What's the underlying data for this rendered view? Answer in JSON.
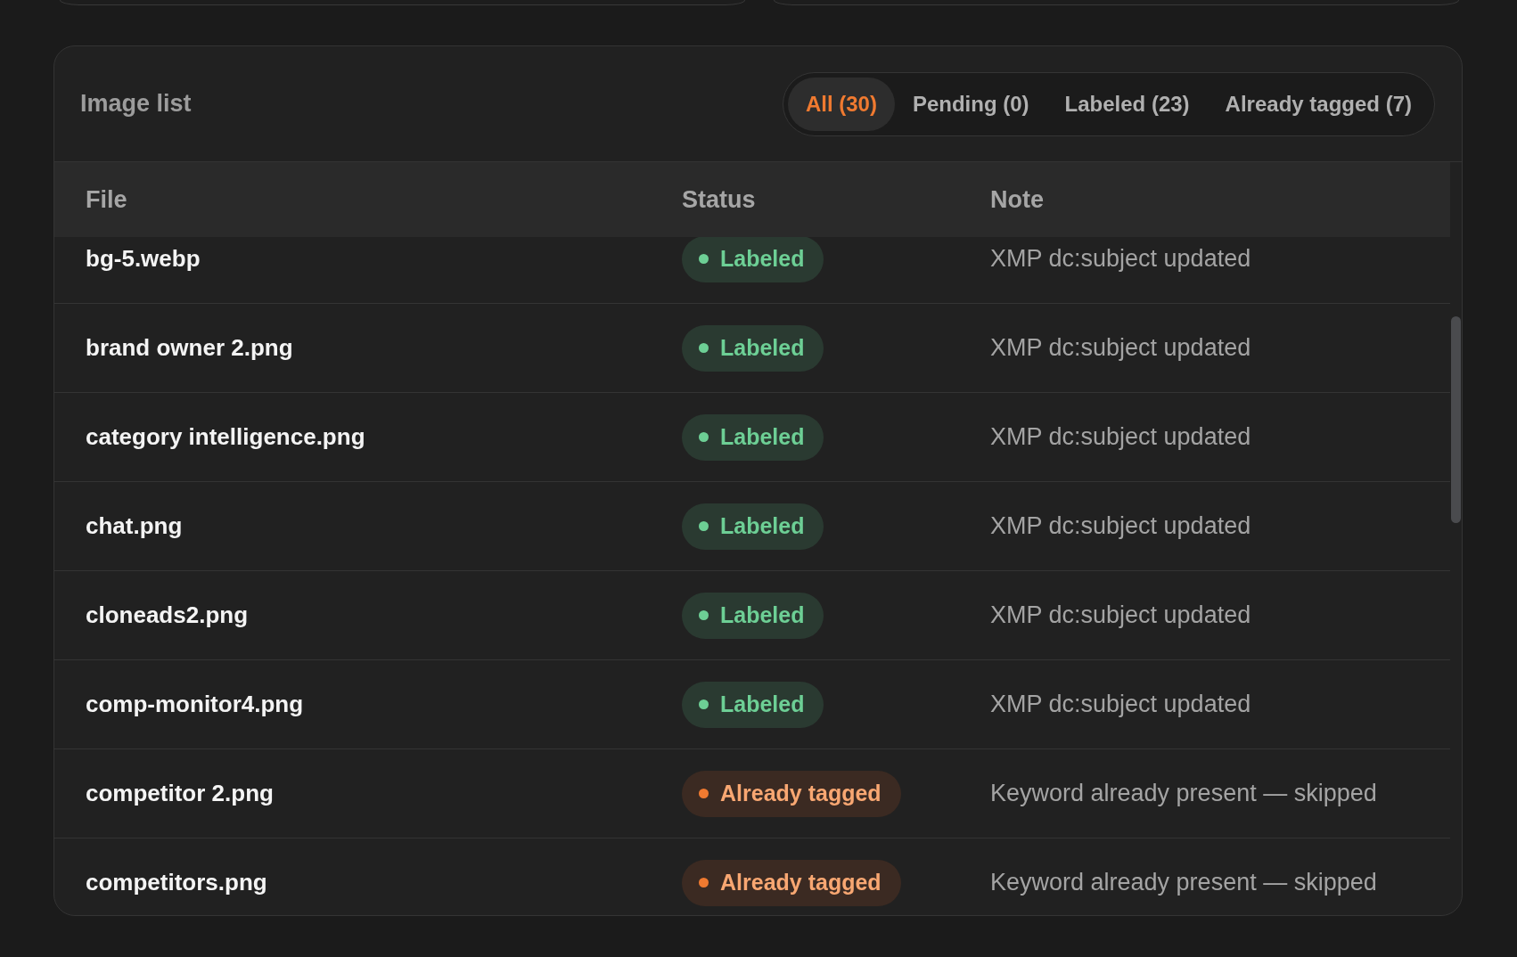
{
  "image_list": {
    "title": "Image list",
    "filters": [
      {
        "label": "All (30)",
        "selected": true
      },
      {
        "label": "Pending (0)",
        "selected": false
      },
      {
        "label": "Labeled (23)",
        "selected": false
      },
      {
        "label": "Already tagged (7)",
        "selected": false
      }
    ],
    "table": {
      "columns": [
        "File",
        "Status",
        "Note"
      ],
      "rows": [
        {
          "file": "bg-5.webp",
          "kind": "labeled",
          "color": "#6dcf95",
          "status": "Labeled",
          "note": "XMP dc:subject updated"
        },
        {
          "file": "brand owner 2.png",
          "kind": "labeled",
          "color": "#6dcf95",
          "status": "Labeled",
          "note": "XMP dc:subject updated"
        },
        {
          "file": "category intelligence.png",
          "kind": "labeled",
          "color": "#6dcf95",
          "status": "Labeled",
          "note": "XMP dc:subject updated"
        },
        {
          "file": "chat.png",
          "kind": "labeled",
          "color": "#6dcf95",
          "status": "Labeled",
          "note": "XMP dc:subject updated"
        },
        {
          "file": "cloneads2.png",
          "kind": "labeled",
          "color": "#6dcf95",
          "status": "Labeled",
          "note": "XMP dc:subject updated"
        },
        {
          "file": "comp-monitor4.png",
          "kind": "labeled",
          "color": "#6dcf95",
          "status": "Labeled",
          "note": "XMP dc:subject updated"
        },
        {
          "file": "competitor 2.png",
          "kind": "tagged",
          "color": "#f07a30",
          "status": "Already tagged",
          "note": "Keyword already present — skipped"
        },
        {
          "file": "competitors.png",
          "kind": "tagged",
          "color": "#f07a30",
          "status": "Already tagged",
          "note": "Keyword already present — skipped"
        }
      ]
    }
  }
}
